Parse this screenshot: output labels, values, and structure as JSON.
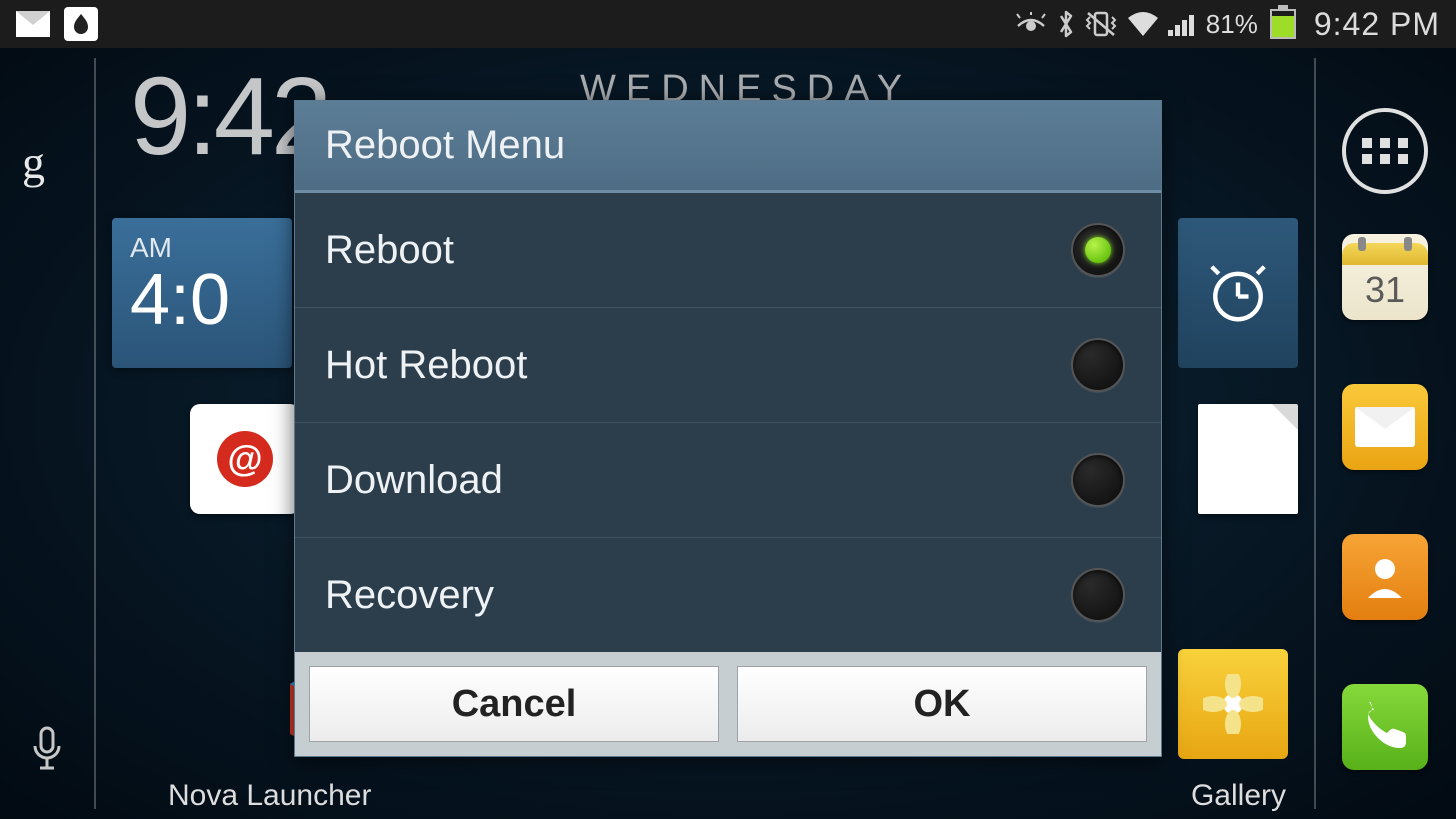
{
  "status_bar": {
    "battery_percent_text": "81%",
    "battery_fill_percent": 81,
    "clock": "9:42 PM"
  },
  "home": {
    "big_clock": "9:42",
    "day": "WEDNESDAY",
    "alarm_ampm": "AM",
    "alarm_time": "4:0",
    "calendar_day": "31",
    "nova_label": "Nova Launcher",
    "gallery_label": "Gallery"
  },
  "dialog": {
    "title": "Reboot Menu",
    "items": [
      {
        "label": "Reboot",
        "selected": true
      },
      {
        "label": "Hot Reboot",
        "selected": false
      },
      {
        "label": "Download",
        "selected": false
      },
      {
        "label": "Recovery",
        "selected": false
      }
    ],
    "cancel": "Cancel",
    "ok": "OK"
  }
}
